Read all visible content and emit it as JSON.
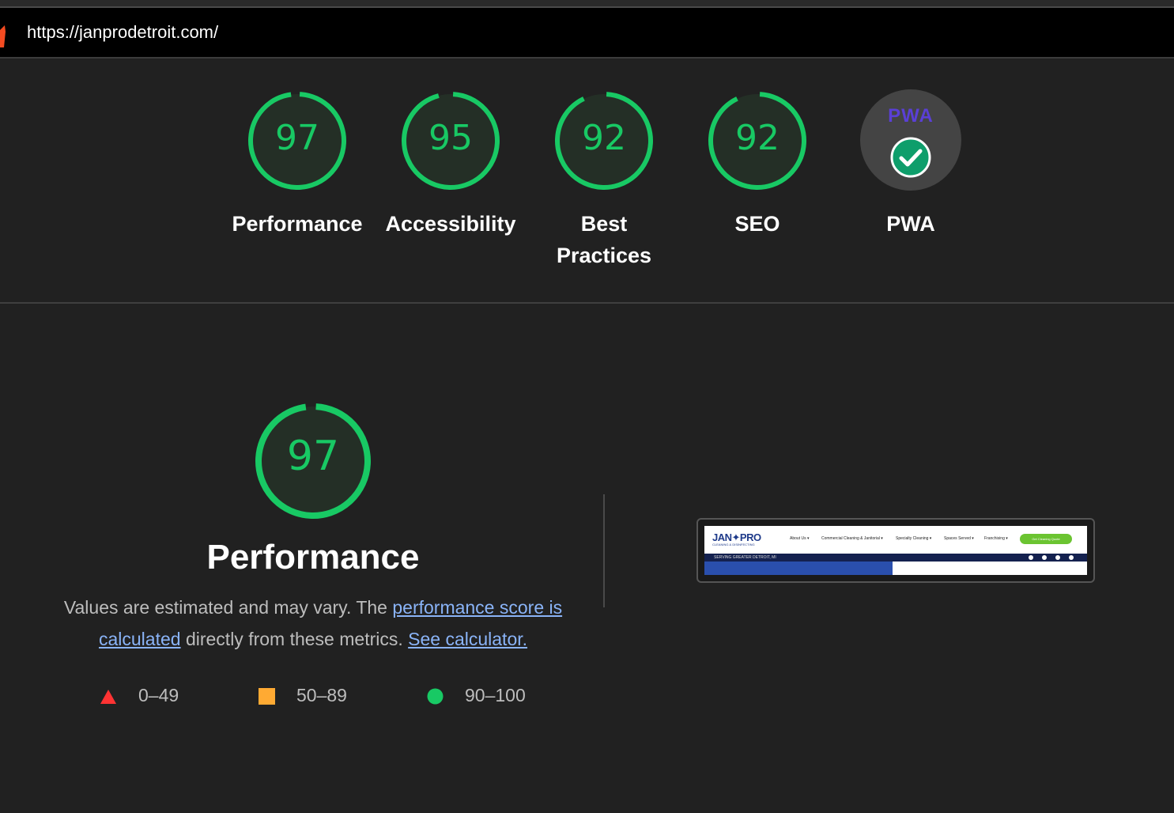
{
  "header": {
    "url": "https://janprodetroit.com/"
  },
  "categories": [
    {
      "id": "performance",
      "label": "Performance",
      "score": "97",
      "value": 97
    },
    {
      "id": "accessibility",
      "label": "Accessibility",
      "score": "95",
      "value": 95
    },
    {
      "id": "best-practices",
      "label_line1": "Best",
      "label_line2": "Practices",
      "score": "92",
      "value": 92
    },
    {
      "id": "seo",
      "label": "SEO",
      "score": "92",
      "value": 92
    }
  ],
  "pwa": {
    "badge_text": "PWA",
    "label": "PWA",
    "icon": "check-circle-icon"
  },
  "performance_detail": {
    "score": "97",
    "value": 97,
    "title": "Performance",
    "desc_prefix": "Values are estimated and may vary. The ",
    "link_score": "performance score is calculated",
    "desc_middle": " directly from these metrics. ",
    "link_calculator": "See calculator."
  },
  "legend": [
    {
      "range": "0–49",
      "shape": "triangle",
      "color": "#f33"
    },
    {
      "range": "50–89",
      "shape": "square",
      "color": "#fa3"
    },
    {
      "range": "90–100",
      "shape": "circle",
      "color": "#18c964"
    }
  ],
  "screenshot": {
    "logo": "JAN✦PRO",
    "logo_sub": "CLEANING & DISINFECTING",
    "nav": [
      "About Us ▾",
      "Commercial Cleaning & Janitorial ▾",
      "Specialty Cleaning ▾",
      "Spaces Served ▾",
      "Franchising ▾"
    ],
    "cta": "Get Cleaning Quote",
    "bar_text": "SERVING GREATER DETROIT, MI"
  },
  "colors": {
    "pass": "#18c964",
    "pass_bg": "#242f26",
    "background": "#212121"
  }
}
